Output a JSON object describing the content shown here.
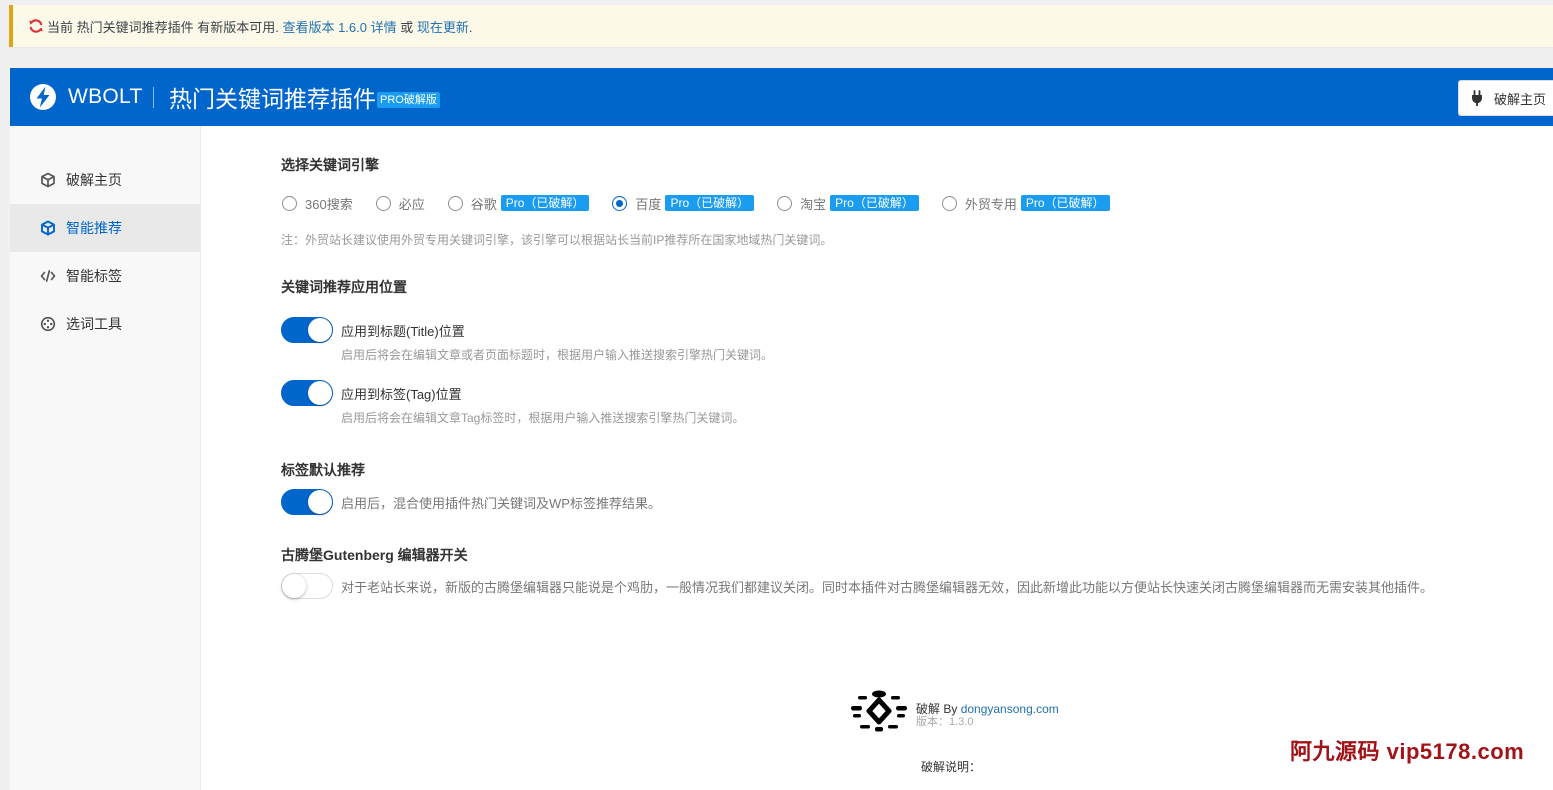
{
  "notice": {
    "icon": "refresh-icon",
    "text_prefix": "当前 热门关键词推荐插件 有新版本可用. ",
    "view_details_link": "查看版本 1.6.0 详情",
    "separator": " 或 ",
    "update_now_link": "现在更新",
    "text_suffix": "."
  },
  "header": {
    "logo_icon": "lightning-bolt-icon",
    "brand": "WBOLT",
    "title": "热门关键词推荐插件",
    "badge": "PRO破解版",
    "home_button": "破解主页",
    "home_button_icon": "plug-icon"
  },
  "sidebar": {
    "items": [
      {
        "label": "破解主页",
        "icon": "cube-icon",
        "active": false
      },
      {
        "label": "智能推荐",
        "icon": "cube-icon",
        "active": true
      },
      {
        "label": "智能标签",
        "icon": "code-icon",
        "active": false
      },
      {
        "label": "选词工具",
        "icon": "target-icon",
        "active": false
      }
    ]
  },
  "engine": {
    "heading": "选择关键词引擎",
    "options": [
      {
        "label": "360搜索",
        "checked": false
      },
      {
        "label": "必应",
        "checked": false
      },
      {
        "label": "谷歌",
        "badge": "Pro（已破解）",
        "checked": false
      },
      {
        "label": "百度",
        "badge": "Pro（已破解）",
        "checked": true
      },
      {
        "label": "淘宝",
        "badge": "Pro（已破解）",
        "checked": false
      },
      {
        "label": "外贸专用",
        "badge": "Pro（已破解）",
        "checked": false
      }
    ],
    "note": "注：外贸站长建议使用外贸专用关键词引擎，该引擎可以根据站长当前IP推荐所在国家地域热门关键词。"
  },
  "position": {
    "heading": "关键词推荐应用位置",
    "title_toggle": {
      "label": "应用到标题(Title)位置",
      "description": "启用后将会在编辑文章或者页面标题时，根据用户输入推送搜索引擎热门关键词。",
      "on": true
    },
    "tag_toggle": {
      "label": "应用到标签(Tag)位置",
      "description": "启用后将会在编辑文章Tag标签时，根据用户输入推送搜索引擎热门关键词。",
      "on": true
    }
  },
  "tag_default": {
    "heading": "标签默认推荐",
    "description": "启用后，混合使用插件热门关键词及WP标签推荐结果。",
    "on": true
  },
  "gutenberg": {
    "heading": "古腾堡Gutenberg 编辑器开关",
    "description": "对于老站长来说，新版的古腾堡编辑器只能说是个鸡肋，一般情况我们都建议关闭。同时本插件对古腾堡编辑器无效，因此新增此功能以方便站长快速关闭古腾堡编辑器而无需安装其他插件。",
    "on": false
  },
  "footer": {
    "credit_prefix": "破解 By ",
    "credit_link": "dongyansong.com",
    "version": "版本：1.3.0",
    "notes_label": "破解说明："
  },
  "watermark": "阿九源码 vip5178.com",
  "colors": {
    "primary": "#0066cc",
    "badge": "#1a9cf0",
    "notice_border": "#dba617",
    "link": "#2271b1",
    "watermark": "#a01418"
  }
}
